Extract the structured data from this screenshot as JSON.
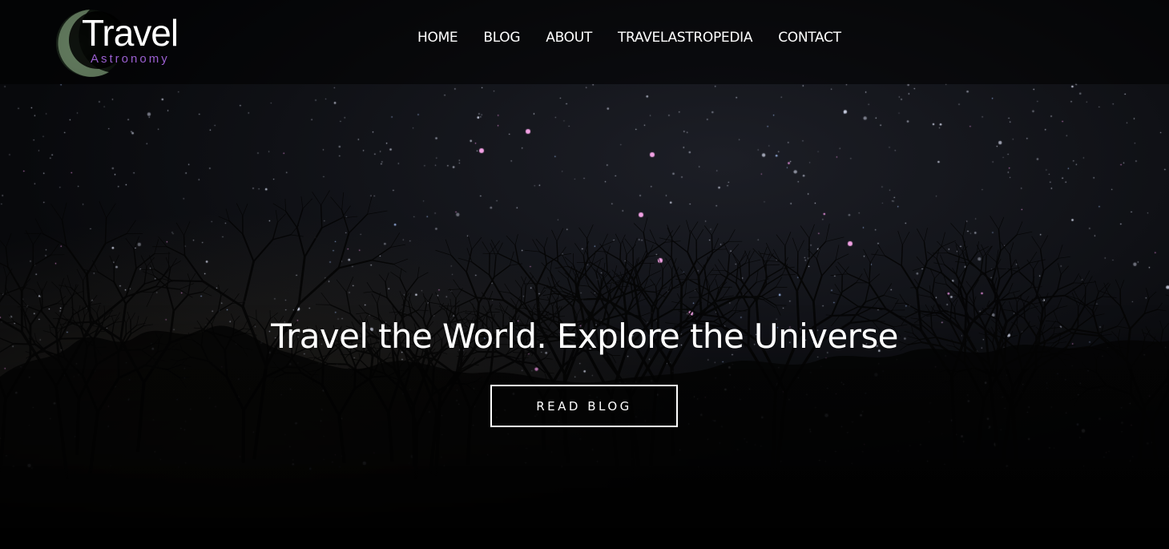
{
  "brand": {
    "title": "Travel",
    "subtitle": "Astronomy",
    "logo_icon": "crescent-moon-icon",
    "accent_color": "#9a5fd0"
  },
  "nav": {
    "items": [
      {
        "label": "HOME"
      },
      {
        "label": "BLOG"
      },
      {
        "label": "ABOUT"
      },
      {
        "label": "TRAVELASTROPEDIA"
      },
      {
        "label": "CONTACT"
      }
    ]
  },
  "hero": {
    "headline": "Travel the World. Explore the Universe",
    "cta_label": "READ BLOG",
    "background": "night-sky-with-tree-silhouettes"
  },
  "colors": {
    "text": "#ffffff",
    "background": "#000000"
  }
}
